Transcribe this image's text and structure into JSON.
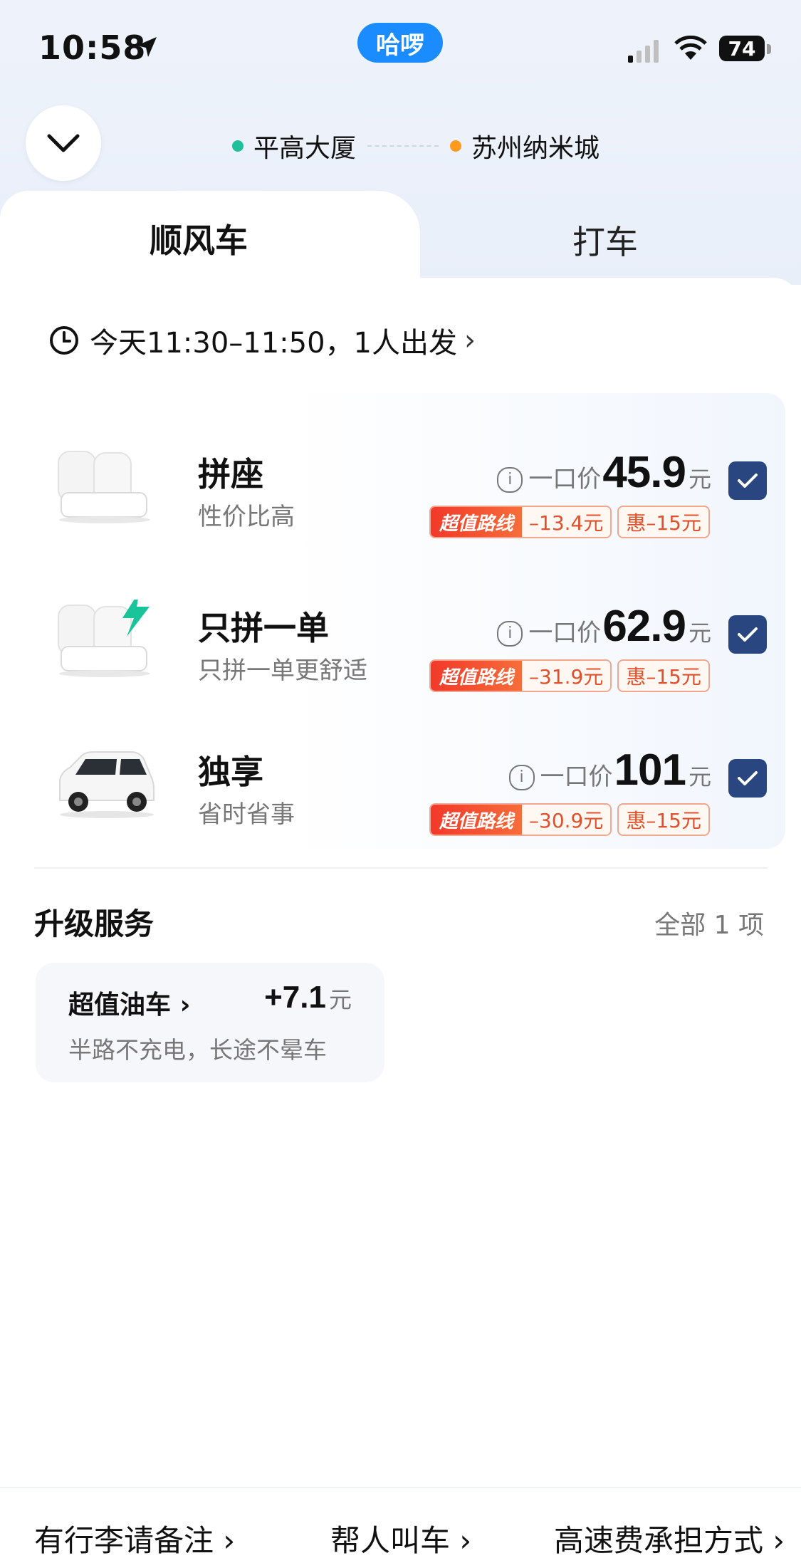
{
  "status_bar": {
    "time": "10:58",
    "app_badge": "哈啰",
    "battery": "74"
  },
  "route": {
    "origin": "平高大厦",
    "destination": "苏州纳米城",
    "origin_color": "#1fbf9b",
    "destination_color": "#ff9a1f"
  },
  "tabs": [
    {
      "label": "顺风车"
    },
    {
      "label": "打车"
    }
  ],
  "departure": {
    "text": "今天11:30–11:50，1人出发",
    "chevron": "›"
  },
  "options": [
    {
      "title": "拼座",
      "subtitle": "性价比高",
      "price_label": "一口价",
      "price": "45.9",
      "unit": "元",
      "tag_label": "超值路线",
      "tag_discount": "–13.4元",
      "tag_hui": "惠–15元",
      "checked": true,
      "icon": "seat-icon"
    },
    {
      "title": "只拼一单",
      "subtitle": "只拼一单更舒适",
      "price_label": "一口价",
      "price": "62.9",
      "unit": "元",
      "tag_label": "超值路线",
      "tag_discount": "–31.9元",
      "tag_hui": "惠–15元",
      "checked": true,
      "icon": "seat-lightning-icon"
    },
    {
      "title": "独享",
      "subtitle": "省时省事",
      "price_label": "一口价",
      "price": "101",
      "unit": "元",
      "tag_label": "超值路线",
      "tag_discount": "–30.9元",
      "tag_hui": "惠–15元",
      "checked": true,
      "icon": "car-icon"
    }
  ],
  "upgrade": {
    "title": "升级服务",
    "all": "全部 1 项",
    "card": {
      "name": "超值油车",
      "chevron": "›",
      "price": "+7.1",
      "unit": "元",
      "desc": "半路不充电，长途不晕车"
    }
  },
  "bottom_bar": [
    {
      "label": "有行李请备注 ›"
    },
    {
      "label": "帮人叫车 ›"
    },
    {
      "label": "高速费承担方式 ›"
    }
  ],
  "colors": {
    "accent": "#2a4680",
    "brand": "#1a8cff",
    "tag_red": "#f2392a"
  }
}
